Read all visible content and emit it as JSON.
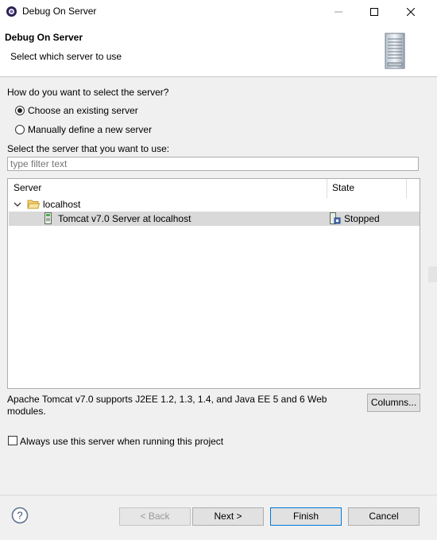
{
  "window": {
    "title": "Debug On Server",
    "app_icon": "eclipse-debug-icon",
    "controls": [
      "minimize-icon",
      "maximize-icon",
      "close-icon"
    ]
  },
  "header": {
    "title": "Debug On Server",
    "subtitle": "Select which server to use",
    "graphic_icon": "server-icon"
  },
  "selection": {
    "question": "How do you want to select the server?",
    "options": [
      {
        "label": "Choose an existing server",
        "selected": true
      },
      {
        "label": "Manually define a new server",
        "selected": false
      }
    ],
    "list_label": "Select the server that you want to use:"
  },
  "filter": {
    "placeholder": "type filter text",
    "value": ""
  },
  "table": {
    "columns": [
      "Server",
      "State"
    ],
    "groups": [
      {
        "name": "localhost",
        "expanded": true,
        "icon": "folder-icon",
        "servers": [
          {
            "name": "Tomcat v7.0 Server at localhost",
            "state": "Stopped",
            "selected": true,
            "icon": "tomcat-server-icon",
            "state_icon": "server-stopped-icon"
          }
        ]
      }
    ]
  },
  "description": "Apache Tomcat v7.0 supports J2EE 1.2, 1.3, 1.4, and Java EE 5 and 6 Web modules.",
  "columns_button": "Columns...",
  "always_use": {
    "label": "Always use this server when running this project",
    "checked": false
  },
  "buttons": {
    "back": "< Back",
    "next": "Next >",
    "finish": "Finish",
    "cancel": "Cancel"
  },
  "colors": {
    "selection": "#d9d9d9",
    "default_button_border": "#0078d7",
    "dialog_background": "#f0f0f0"
  }
}
